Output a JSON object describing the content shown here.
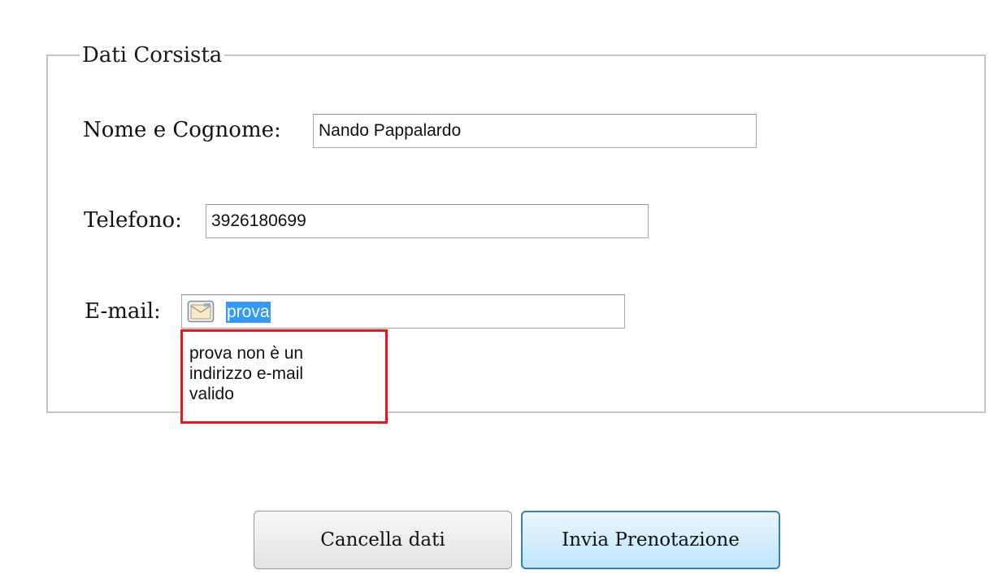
{
  "form": {
    "legend": "Dati Corsista",
    "fields": {
      "name": {
        "label": "Nome e Cognome:",
        "value": "Nando Pappalardo"
      },
      "phone": {
        "label": "Telefono:",
        "value": "3926180699"
      },
      "email": {
        "label": "E-mail:",
        "value": "prova",
        "icon": "email-card-icon"
      }
    },
    "validation": {
      "email_error_lines": [
        "prova non è un",
        "indirizzo e-mail",
        "valido"
      ]
    }
  },
  "buttons": {
    "cancel_label": "Cancella dati",
    "submit_label": "Invia Prenotazione"
  },
  "colors": {
    "error_border": "#e8141e",
    "selection": "#3399ff",
    "primary_button": "#bde6fd"
  }
}
